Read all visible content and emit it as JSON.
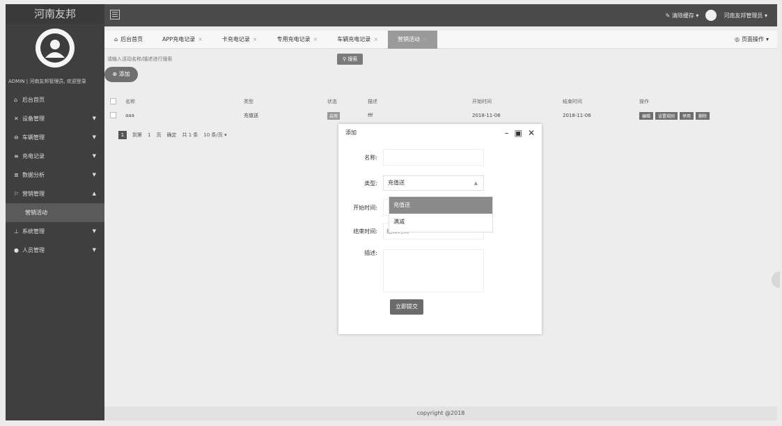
{
  "sidebar": {
    "brand": "河南友邦",
    "user_line": "ADMIN | 河南友邦管理员, 欢迎登录",
    "items": [
      {
        "icon": "home-icon",
        "glyph": "⌂",
        "label": "后台首页",
        "has_caret": false
      },
      {
        "icon": "tool-icon",
        "glyph": "✕",
        "label": "设备管理",
        "has_caret": true
      },
      {
        "icon": "car-icon",
        "glyph": "⊖",
        "label": "车辆管理",
        "has_caret": true
      },
      {
        "icon": "record-icon",
        "glyph": "≡",
        "label": "充电记录",
        "has_caret": true
      },
      {
        "icon": "chart-icon",
        "glyph": "≣",
        "label": "数据分析",
        "has_caret": true
      },
      {
        "icon": "flag-icon",
        "glyph": "⚐",
        "label": "营销管理",
        "has_caret": true,
        "expanded": true
      },
      {
        "icon": "user-icon",
        "glyph": "⊥",
        "label": "系统管理",
        "has_caret": true
      },
      {
        "icon": "people-icon",
        "glyph": "●",
        "label": "人员管理",
        "has_caret": true
      }
    ],
    "sub_item": "营销活动"
  },
  "topbar": {
    "notification": "清除缓存",
    "user": "河南友邦管理员"
  },
  "tabs": [
    {
      "label": "后台首页",
      "closable": false,
      "active": false
    },
    {
      "label": "APP充电记录",
      "closable": true,
      "active": false
    },
    {
      "label": "卡充电记录",
      "closable": true,
      "active": false
    },
    {
      "label": "专用充电记录",
      "closable": true,
      "active": false
    },
    {
      "label": "车辆充电记录",
      "closable": true,
      "active": false
    },
    {
      "label": "营销活动",
      "closable": true,
      "active": true
    }
  ],
  "page_ops": "页面操作",
  "search": {
    "placeholder": "请输入活动名称/描述进行搜索",
    "button": "搜索"
  },
  "add_button": "添加",
  "table": {
    "headers": [
      "",
      "名称",
      "类型",
      "状态",
      "描述",
      "开始时间",
      "结束时间",
      "操作"
    ],
    "rows": [
      {
        "name": "aaa",
        "type": "充值送",
        "status": "启用",
        "desc": "fff",
        "start": "2018-11-06",
        "end": "2018-11-06",
        "ops": [
          "编辑",
          "设置规则",
          "停用",
          "删除"
        ]
      }
    ]
  },
  "pager": {
    "current": "1",
    "goto_label": "到第",
    "page_value": "1",
    "page_unit": "页",
    "confirm": "确定",
    "total": "共 1 条",
    "per_page": "10 条/页"
  },
  "footer": "copyright @2018",
  "modal": {
    "title": "添加",
    "fields": {
      "name_label": "名称:",
      "type_label": "类型:",
      "type_value": "充值送",
      "start_label": "开始时间:",
      "end_label": "结束时间:",
      "end_placeholder": "结束时间",
      "desc_label": "描述:"
    },
    "dropdown": [
      "充值送",
      "满减"
    ],
    "submit": "立即提交"
  }
}
